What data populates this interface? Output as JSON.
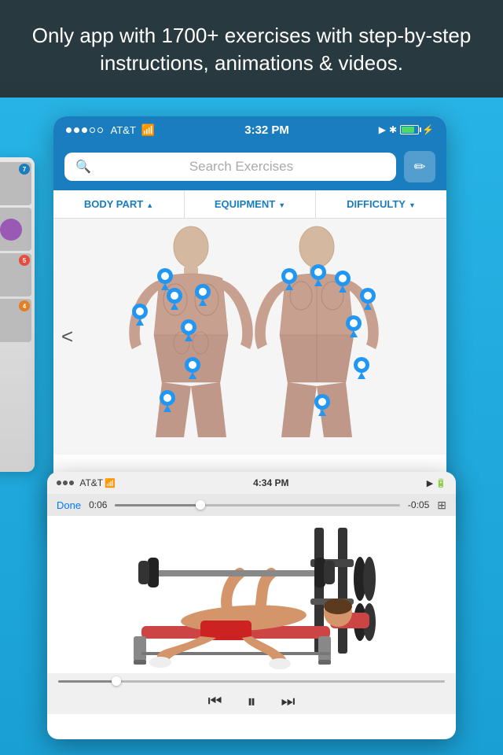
{
  "banner": {
    "text": "Only app with 1700+ exercises with step-by-step instructions, animations & videos."
  },
  "phone_main": {
    "status_bar": {
      "carrier": "AT&T",
      "wifi": "WiFi",
      "time": "3:32 PM",
      "location": "◀",
      "bluetooth": "✱",
      "battery": "80%"
    },
    "search": {
      "placeholder": "Search Exercises",
      "edit_icon": "✏"
    },
    "filters": [
      {
        "label": "BODY PART",
        "arrow": "up"
      },
      {
        "label": "EQUIPMENT",
        "arrow": "down"
      },
      {
        "label": "DIFFICULTY",
        "arrow": "down"
      }
    ],
    "back_arrow": "<"
  },
  "phone_video": {
    "status_bar": {
      "carrier": "AT&T",
      "wifi": "WiFi",
      "time": "4:34 PM",
      "right_icons": ""
    },
    "player_bar": {
      "done": "Done",
      "time_start": "0:06",
      "time_end": "-0:05"
    },
    "controls": {
      "rewind": "⏮",
      "pause": "⏸",
      "forward": "⏭"
    }
  },
  "left_phone": {
    "items": [
      {
        "badge_color": "#1a7dbf",
        "badge_num": "7"
      },
      {
        "badge_color": "#9b59b6",
        "badge_num": ""
      },
      {
        "badge_color": "#e74c3c",
        "badge_num": "5"
      },
      {
        "badge_color": "#e67e22",
        "badge_num": "4"
      }
    ]
  }
}
